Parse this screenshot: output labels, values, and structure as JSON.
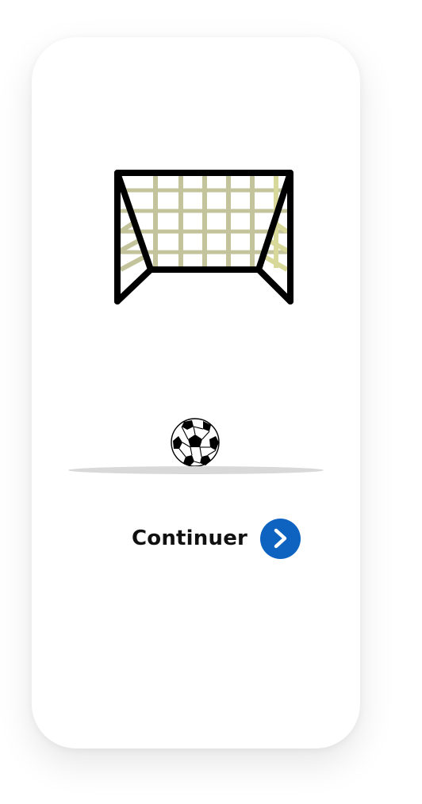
{
  "screen": {
    "background": "#ffffff"
  },
  "illustration": {
    "goal_icon": "soccer-goal-icon",
    "ball_icon": "soccer-ball-icon",
    "net_color_left": "#c4c49c",
    "net_color_right": "#d8d89a",
    "frame_color": "#000000",
    "ground_color": "#d9d9d9"
  },
  "actions": {
    "continue_label": "Continuer",
    "continue_icon": "chevron-right-icon",
    "accent_color": "#0e63c1"
  }
}
